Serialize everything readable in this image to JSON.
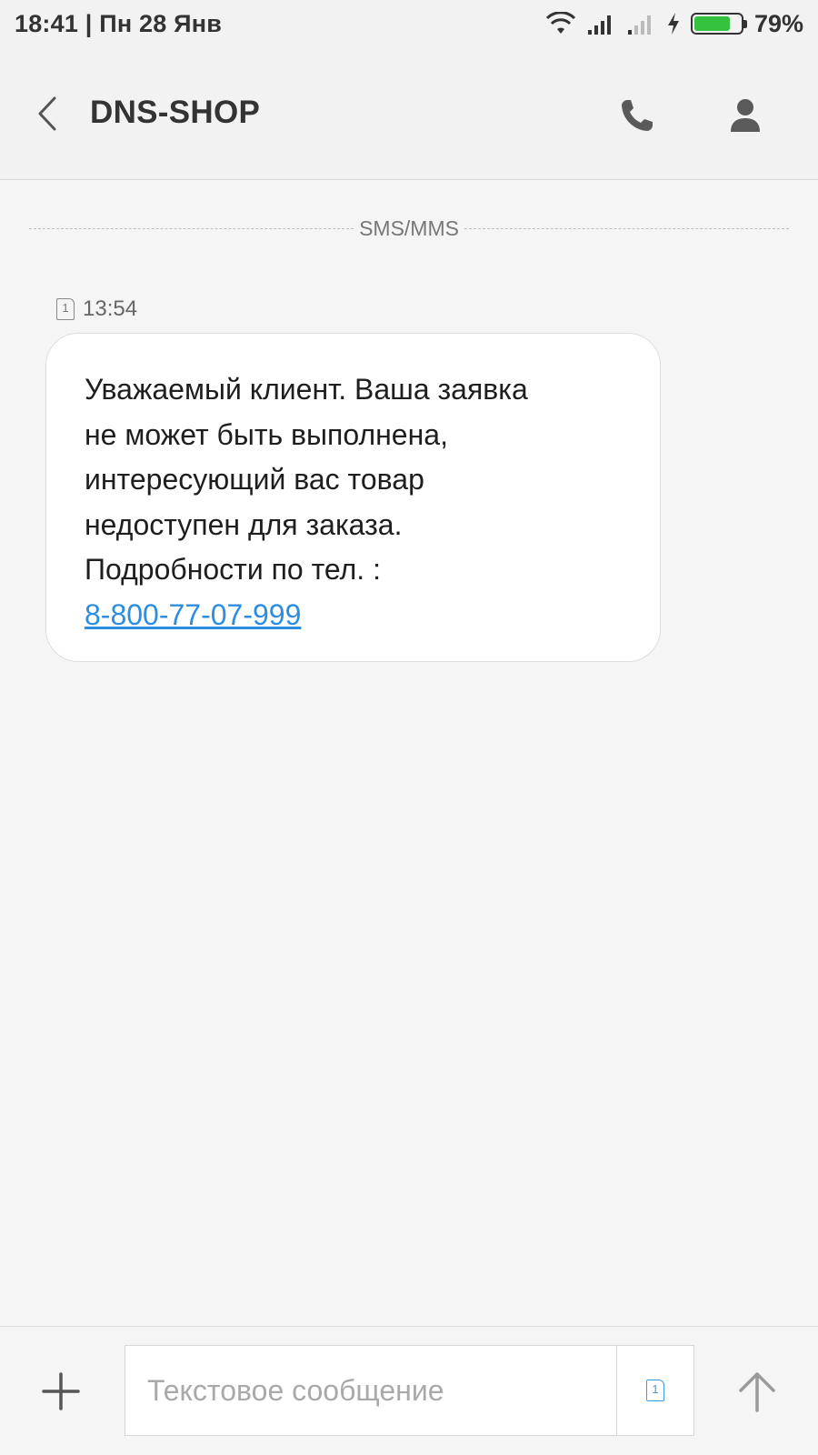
{
  "status_bar": {
    "time_date": "18:41 | Пн 28 Янв",
    "battery_percent": "79%",
    "battery_level": 0.79,
    "icons": [
      "wifi-icon",
      "signal-icon",
      "signal-weak-icon",
      "charging-icon",
      "battery-icon"
    ]
  },
  "header": {
    "title": "DNS-SHOP",
    "icons": [
      "back-arrow-icon",
      "phone-icon",
      "contact-icon"
    ]
  },
  "conversation": {
    "channel_label": "SMS/MMS",
    "messages": [
      {
        "sim_slot": "1",
        "time": "13:54",
        "lines": [
          "Уважаемый клиент. Ваша заявка",
          "не может быть выполнена,",
          "интересующий вас товар",
          "недоступен для заказа.",
          "Подробности по тел. :"
        ],
        "phone_link": "8-800-77-07-999"
      }
    ]
  },
  "composer": {
    "placeholder": "Текстовое сообщение",
    "value": "",
    "sim_slot": "1",
    "icons": [
      "plus-icon",
      "sim-card-icon",
      "send-arrow-icon"
    ]
  },
  "colors": {
    "background": "#f5f5f5",
    "bubble": "#ffffff",
    "link": "#2f8de0",
    "battery": "#35c23f",
    "sim_accent": "#3d9ae6"
  }
}
